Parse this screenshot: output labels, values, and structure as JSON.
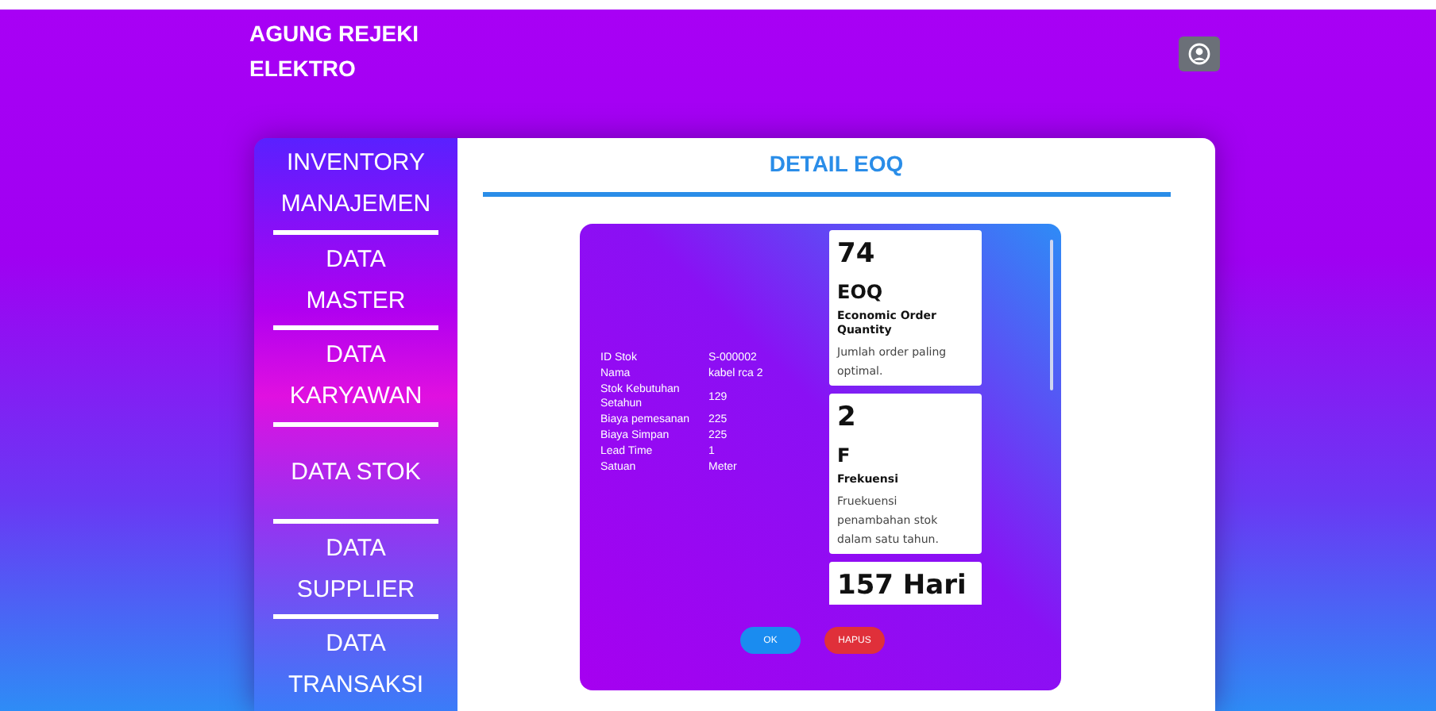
{
  "brand": {
    "lines": [
      "AGUNG REJEKI",
      "ELEKTRO"
    ]
  },
  "sidebar": {
    "items": [
      {
        "lines": [
          "INVENTORY",
          "MANAJEMEN"
        ]
      },
      {
        "lines": [
          "DATA",
          "MASTER"
        ]
      },
      {
        "lines": [
          "DATA",
          "KARYAWAN"
        ]
      },
      {
        "lines": [
          "DATA STOK"
        ]
      },
      {
        "lines": [
          "DATA",
          "SUPPLIER"
        ]
      },
      {
        "lines": [
          "DATA",
          "TRANSAKSI"
        ]
      }
    ]
  },
  "main": {
    "title": "DETAIL EOQ"
  },
  "details": [
    {
      "label": "ID Stok",
      "value": "S-000002"
    },
    {
      "label": "Nama",
      "value": "kabel rca 2"
    },
    {
      "label": "Stok Kebutuhan Setahun",
      "value": "129"
    },
    {
      "label": "Biaya pemesanan",
      "value": "225"
    },
    {
      "label": "Biaya Simpan",
      "value": "225"
    },
    {
      "label": "Lead Time",
      "value": "1"
    },
    {
      "label": "Satuan",
      "value": "Meter"
    }
  ],
  "cards": [
    {
      "value": "74",
      "code": "EOQ",
      "name": "Economic Order Quantity",
      "description": "Jumlah order paling optimal."
    },
    {
      "value": "2",
      "code": "F",
      "name": "Frekuensi",
      "description": "Fruekuensi penambahan stok dalam satu tahun."
    },
    {
      "value": "157 Hari"
    }
  ],
  "buttons": [
    {
      "label": "OK",
      "kind": "primary"
    },
    {
      "label": "HAPUS",
      "kind": "danger"
    }
  ]
}
